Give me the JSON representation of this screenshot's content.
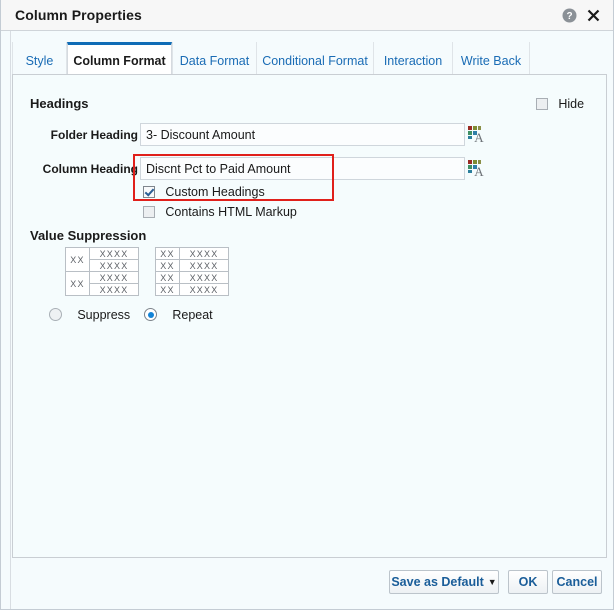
{
  "window": {
    "title": "Column Properties",
    "help_icon": "help-circle-icon",
    "close_icon": "close-x-icon"
  },
  "tabs": [
    {
      "label": "Style",
      "active": false
    },
    {
      "label": "Column Format",
      "active": true
    },
    {
      "label": "Data Format",
      "active": false
    },
    {
      "label": "Conditional Format",
      "active": false
    },
    {
      "label": "Interaction",
      "active": false
    },
    {
      "label": "Write Back",
      "active": false
    }
  ],
  "headings": {
    "group_title": "Headings",
    "hide_label": "Hide",
    "hide_checked": false,
    "folder_label": "Folder Heading",
    "folder_value": "3- Discount Amount",
    "column_label": "Column Heading",
    "column_value": "Discnt Pct to Paid Amount",
    "custom_headings_label": "Custom Headings",
    "custom_headings_checked": true,
    "contains_html_label": "Contains HTML Markup",
    "contains_html_checked": false,
    "format_icon": "text-format-icon",
    "highlight_color": "#e0201b"
  },
  "value_suppression": {
    "group_title": "Value Suppression",
    "suppress_label": "Suppress",
    "repeat_label": "Repeat",
    "selected": "Repeat",
    "sample_cell_group": "XX",
    "sample_cell_value": "XXXX",
    "suppress_sample": [
      {
        "group": "XX",
        "rows": [
          "XXXX",
          "XXXX"
        ]
      },
      {
        "group": "XX",
        "rows": [
          "XXXX",
          "XXXX"
        ]
      }
    ],
    "repeat_sample": [
      {
        "group": "XX",
        "value": "XXXX"
      },
      {
        "group": "XX",
        "value": "XXXX"
      },
      {
        "group": "XX",
        "value": "XXXX"
      },
      {
        "group": "XX",
        "value": "XXXX"
      }
    ]
  },
  "footer": {
    "save_as_default_label": "Save as Default",
    "save_as_default_caret": "▼",
    "ok_label": "OK",
    "cancel_label": "Cancel"
  },
  "colors": {
    "accent": "#0f6cb6",
    "link": "#1a6cb5",
    "panel_bg": "#f5fcfd",
    "titlebar_bg": "#f7f7f7",
    "highlight": "#e0201b"
  }
}
